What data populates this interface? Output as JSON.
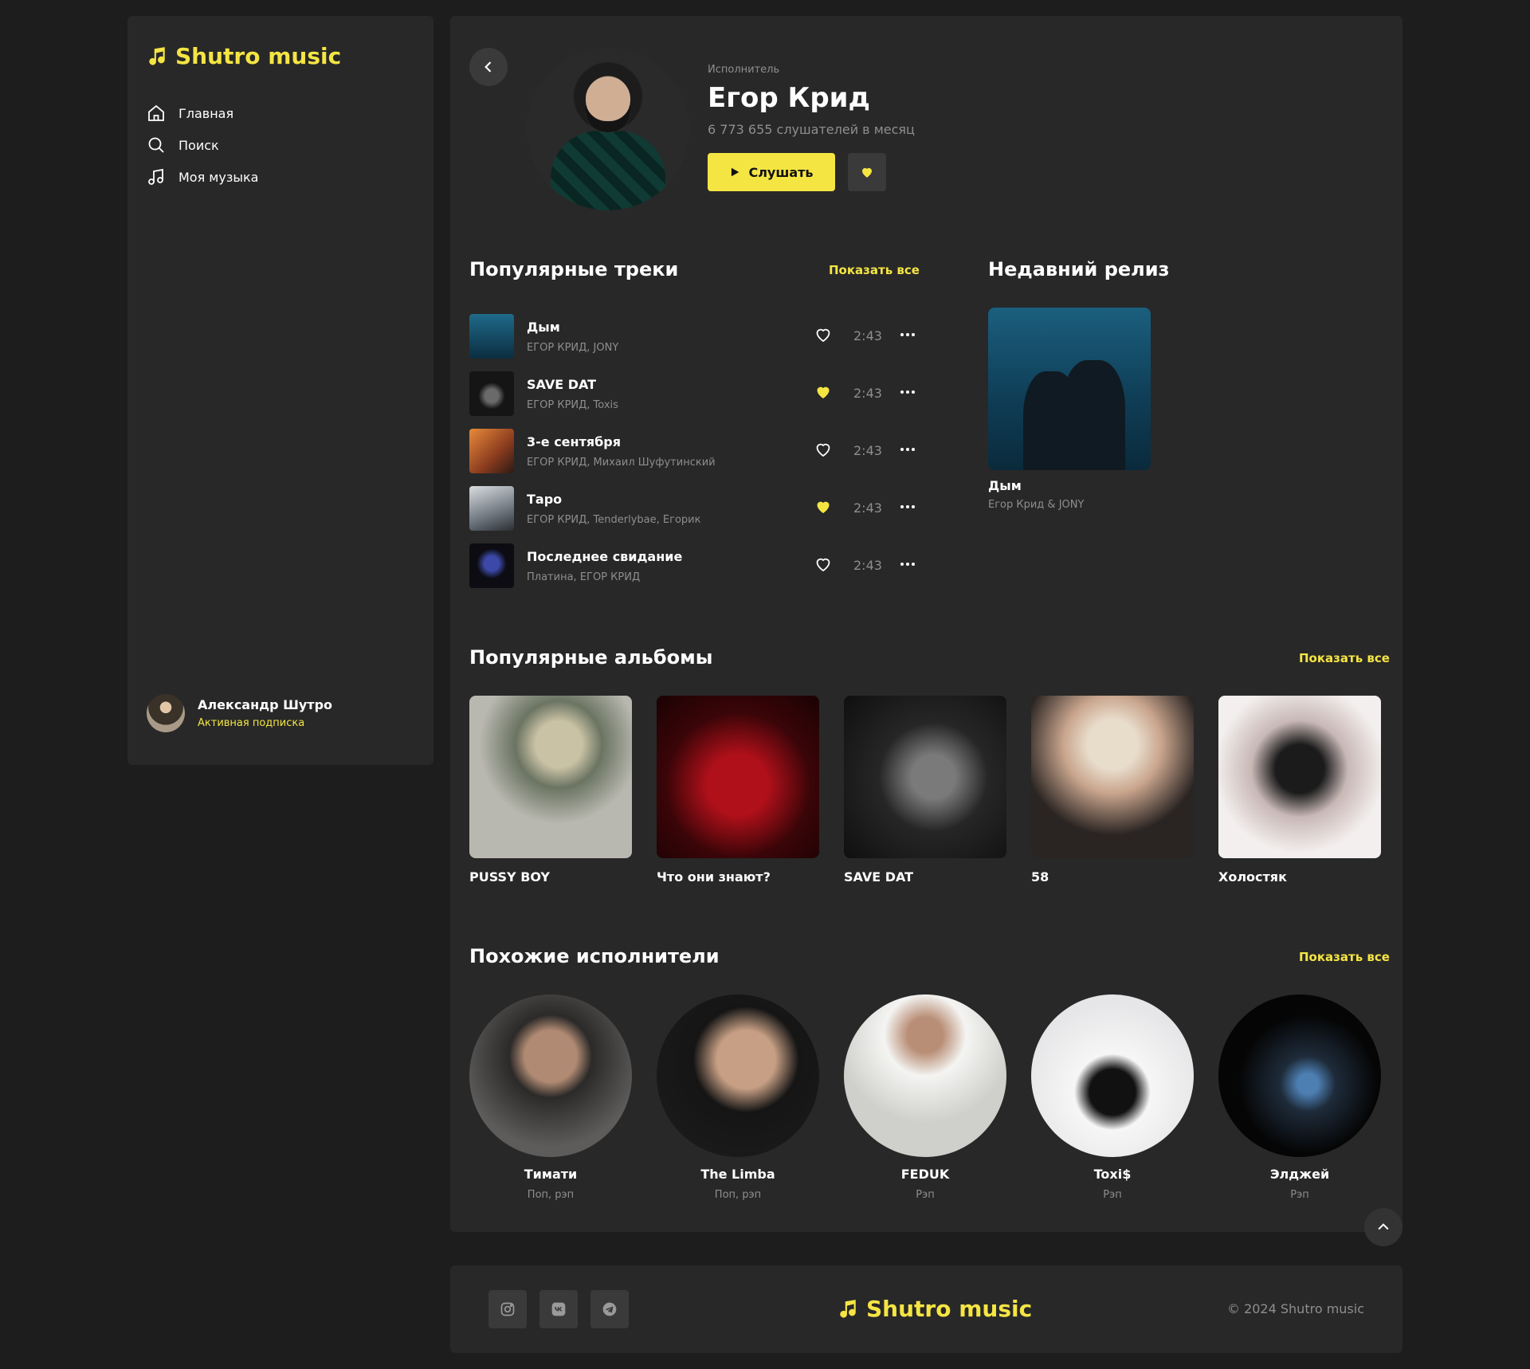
{
  "app": {
    "name": "Shutro music"
  },
  "nav": [
    {
      "label": "Главная",
      "icon": "home-icon"
    },
    {
      "label": "Поиск",
      "icon": "search-icon"
    },
    {
      "label": "Моя музыка",
      "icon": "music-note-icon"
    }
  ],
  "user": {
    "name": "Александр Шутро",
    "status": "Активная подписка"
  },
  "artist": {
    "kind": "Исполнитель",
    "name": "Егор Крид",
    "listeners": "6 773 655 слушателей в месяц",
    "play_label": "Слушать",
    "favorited": true
  },
  "popular_tracks": {
    "title": "Популярные треки",
    "show_all": "Показать все",
    "items": [
      {
        "title": "Дым",
        "artists": "ЕГОР КРИД, JONY",
        "duration": "2:43",
        "liked": false
      },
      {
        "title": "SAVE DAT",
        "artists": "ЕГОР КРИД, Toxis",
        "duration": "2:43",
        "liked": true
      },
      {
        "title": "3-е сентября",
        "artists": "ЕГОР КРИД, Михаил Шуфутинский",
        "duration": "2:43",
        "liked": false
      },
      {
        "title": "Таро",
        "artists": "ЕГОР КРИД, Tenderlybae, Егорик",
        "duration": "2:43",
        "liked": true
      },
      {
        "title": "Последнее свидание",
        "artists": "Платина, ЕГОР КРИД",
        "duration": "2:43",
        "liked": false
      }
    ]
  },
  "recent_release": {
    "heading": "Недавний релиз",
    "title": "Дым",
    "artists": "Егор Крид & JONY"
  },
  "popular_albums": {
    "title": "Популярные альбомы",
    "show_all": "Показать все",
    "items": [
      {
        "title": "PUSSY BOY"
      },
      {
        "title": "Что они знают?"
      },
      {
        "title": "SAVE DAT"
      },
      {
        "title": "58"
      },
      {
        "title": "Холостяк"
      }
    ]
  },
  "similar_artists": {
    "title": "Похожие исполнители",
    "show_all": "Показать все",
    "items": [
      {
        "name": "Тимати",
        "genre": "Поп, рэп"
      },
      {
        "name": "The Limba",
        "genre": "Поп, рэп"
      },
      {
        "name": "FEDUK",
        "genre": "Рэп"
      },
      {
        "name": "Toxi$",
        "genre": "Рэп"
      },
      {
        "name": "Элджей",
        "genre": "Рэп"
      }
    ]
  },
  "footer": {
    "socials": [
      "instagram-icon",
      "vk-icon",
      "telegram-icon"
    ],
    "logo": "Shutro music",
    "copyright": "© 2024  Shutro music"
  },
  "colors": {
    "accent": "#f5e543",
    "background": "#1d1d1d",
    "panel": "#282828",
    "muted": "#8e8e8e"
  }
}
